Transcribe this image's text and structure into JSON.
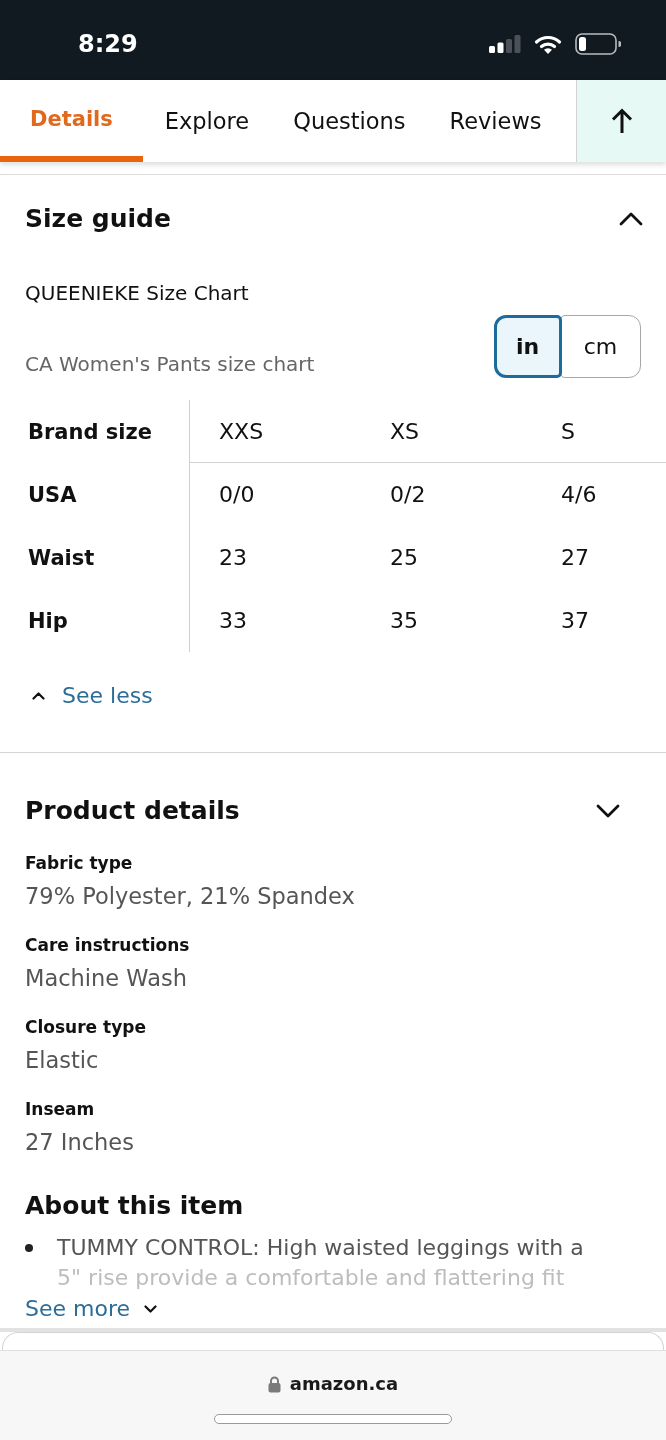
{
  "status_bar": {
    "time": "8:29"
  },
  "tabs": [
    {
      "label": "Details",
      "selected": true
    },
    {
      "label": "Explore",
      "selected": false
    },
    {
      "label": "Questions",
      "selected": false
    },
    {
      "label": "Reviews",
      "selected": false
    }
  ],
  "size_guide": {
    "title": "Size guide",
    "expanded": true,
    "chart_title": "QUEENIEKE Size Chart",
    "chart_subtitle": "CA Women's Pants size chart",
    "units": [
      {
        "label": "in",
        "selected": true
      },
      {
        "label": "cm",
        "selected": false
      }
    ],
    "table": {
      "columns": [
        "Brand size",
        "XXS",
        "XS",
        "S"
      ],
      "rows": [
        [
          "USA",
          "0/0",
          "0/2",
          "4/6"
        ],
        [
          "Waist",
          "23",
          "25",
          "27"
        ],
        [
          "Hip",
          "33",
          "35",
          "37"
        ]
      ]
    },
    "toggle_link": "See less"
  },
  "product_details": {
    "title": "Product details",
    "expanded": false,
    "items": [
      {
        "label": "Fabric type",
        "value": "79% Polyester, 21% Spandex"
      },
      {
        "label": "Care instructions",
        "value": "Machine Wash"
      },
      {
        "label": "Closure type",
        "value": "Elastic"
      },
      {
        "label": "Inseam",
        "value": "27 Inches"
      }
    ]
  },
  "about_item": {
    "title": "About this item",
    "bullets": [
      "TUMMY CONTROL: High waisted leggings with a 5\" rise provide a comfortable and flattering fit"
    ],
    "more_link": "See more"
  },
  "browser_bar": {
    "url": "amazon.ca"
  }
}
